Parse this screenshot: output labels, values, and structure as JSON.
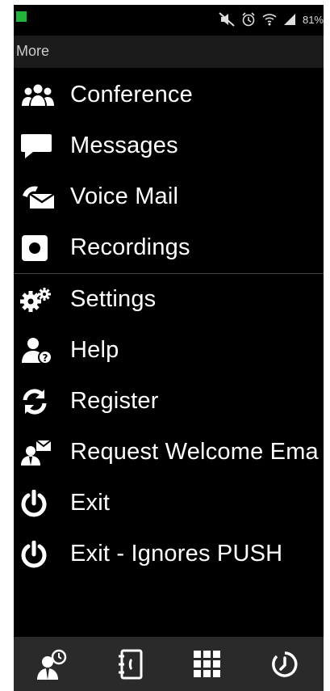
{
  "status_bar": {
    "battery_text": "81%",
    "icons": [
      "notification-square",
      "mute-icon",
      "alarm-icon",
      "wifi-icon",
      "signal-icon",
      "battery-icon"
    ]
  },
  "app_bar": {
    "title": "More"
  },
  "menu": {
    "items": [
      {
        "label": "Conference",
        "icon": "conference-icon"
      },
      {
        "label": "Messages",
        "icon": "message-icon"
      },
      {
        "label": "Voice Mail",
        "icon": "voicemail-icon"
      },
      {
        "label": "Recordings",
        "icon": "recording-icon"
      },
      {
        "label": "Settings",
        "icon": "settings-icon"
      },
      {
        "label": "Help",
        "icon": "help-icon"
      },
      {
        "label": "Register",
        "icon": "register-icon"
      },
      {
        "label": "Request Welcome Ema",
        "icon": "welcome-email-icon"
      },
      {
        "label": "Exit",
        "icon": "power-icon"
      },
      {
        "label": "Exit - Ignores PUSH",
        "icon": "power-icon"
      }
    ]
  },
  "bottom_nav": {
    "tabs": [
      "contacts-status-icon",
      "phonebook-icon",
      "dialpad-icon",
      "history-icon"
    ]
  },
  "colors": {
    "background": "#000000",
    "appbar": "#1b1b1b",
    "bottom_bar": "#2a2a2a",
    "notification": "#21b63a"
  }
}
